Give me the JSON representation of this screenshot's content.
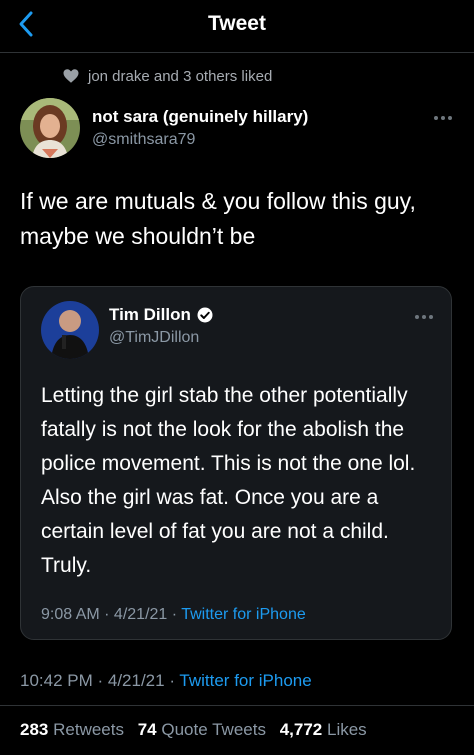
{
  "header": {
    "title": "Tweet",
    "back_icon": "chevron-left-icon"
  },
  "social_context": {
    "icon": "heart-icon",
    "text": "jon drake and 3 others liked"
  },
  "tweet": {
    "author_name": "not sara (genuinely hillary)",
    "author_handle": "@smithsara79",
    "text": "If we are mutuals & you follow this guy, maybe we shouldn’t be",
    "time": "10:42 PM · 4/21/21 · ",
    "source": "Twitter for iPhone"
  },
  "quoted_tweet": {
    "author_name": "Tim Dillon",
    "verified": true,
    "author_handle": "@TimJDillon",
    "text": "Letting the girl stab the other potentially fatally is not the look for the abolish the police movement. This is not the one lol. Also the girl was fat. Once you are a certain level of fat you are not a child. Truly.",
    "time": "9:08 AM · 4/21/21 · ",
    "source": "Twitter for iPhone"
  },
  "stats": {
    "retweets_count": "283",
    "retweets_label": "Retweets",
    "quotes_count": "74",
    "quotes_label": "Quote Tweets",
    "likes_count": "4,772",
    "likes_label": "Likes"
  },
  "colors": {
    "background": "#000000",
    "link": "#1d9bf0",
    "secondary_text": "#8b98a5",
    "card_background": "#15181c"
  }
}
